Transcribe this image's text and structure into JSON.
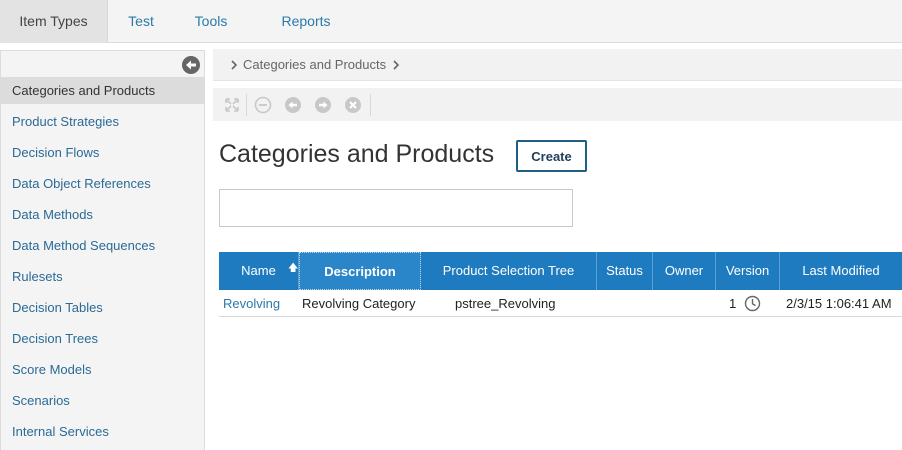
{
  "topnav": {
    "tabs": [
      {
        "label": "Item Types",
        "active": true
      },
      {
        "label": "Test",
        "active": false
      },
      {
        "label": "Tools",
        "active": false
      },
      {
        "label": "Reports",
        "active": false
      }
    ]
  },
  "sidebar": {
    "items": [
      {
        "label": "Categories and Products",
        "selected": true
      },
      {
        "label": "Product Strategies"
      },
      {
        "label": "Decision Flows"
      },
      {
        "label": "Data Object References"
      },
      {
        "label": "Data Methods"
      },
      {
        "label": "Data Method Sequences"
      },
      {
        "label": "Rulesets"
      },
      {
        "label": "Decision Tables"
      },
      {
        "label": "Decision Trees"
      },
      {
        "label": "Score Models"
      },
      {
        "label": "Scenarios"
      },
      {
        "label": "Internal Services"
      }
    ]
  },
  "breadcrumb": {
    "current": "Categories and Products"
  },
  "toolbar": {
    "icons": [
      "expand-icon",
      "minus-circle-icon",
      "back-circle-icon",
      "forward-circle-icon",
      "close-circle-icon"
    ]
  },
  "main": {
    "title": "Categories and Products",
    "create_label": "Create",
    "filter_value": ""
  },
  "table": {
    "columns": [
      "Name",
      "Description",
      "Product Selection Tree",
      "Status",
      "Owner",
      "Version",
      "Last Modified"
    ],
    "sorted_column": "Name",
    "rows": [
      {
        "name": "Revolving",
        "description": "Revolving Category",
        "product_selection_tree": "pstree_Revolving",
        "status": "",
        "owner": "",
        "version": "1",
        "last_modified": "2/3/15 1:06:41 AM"
      }
    ]
  },
  "colors": {
    "header_blue": "#1f7bbf",
    "link_blue": "#2a7aa8",
    "selected_gray": "#dcdcdc"
  }
}
